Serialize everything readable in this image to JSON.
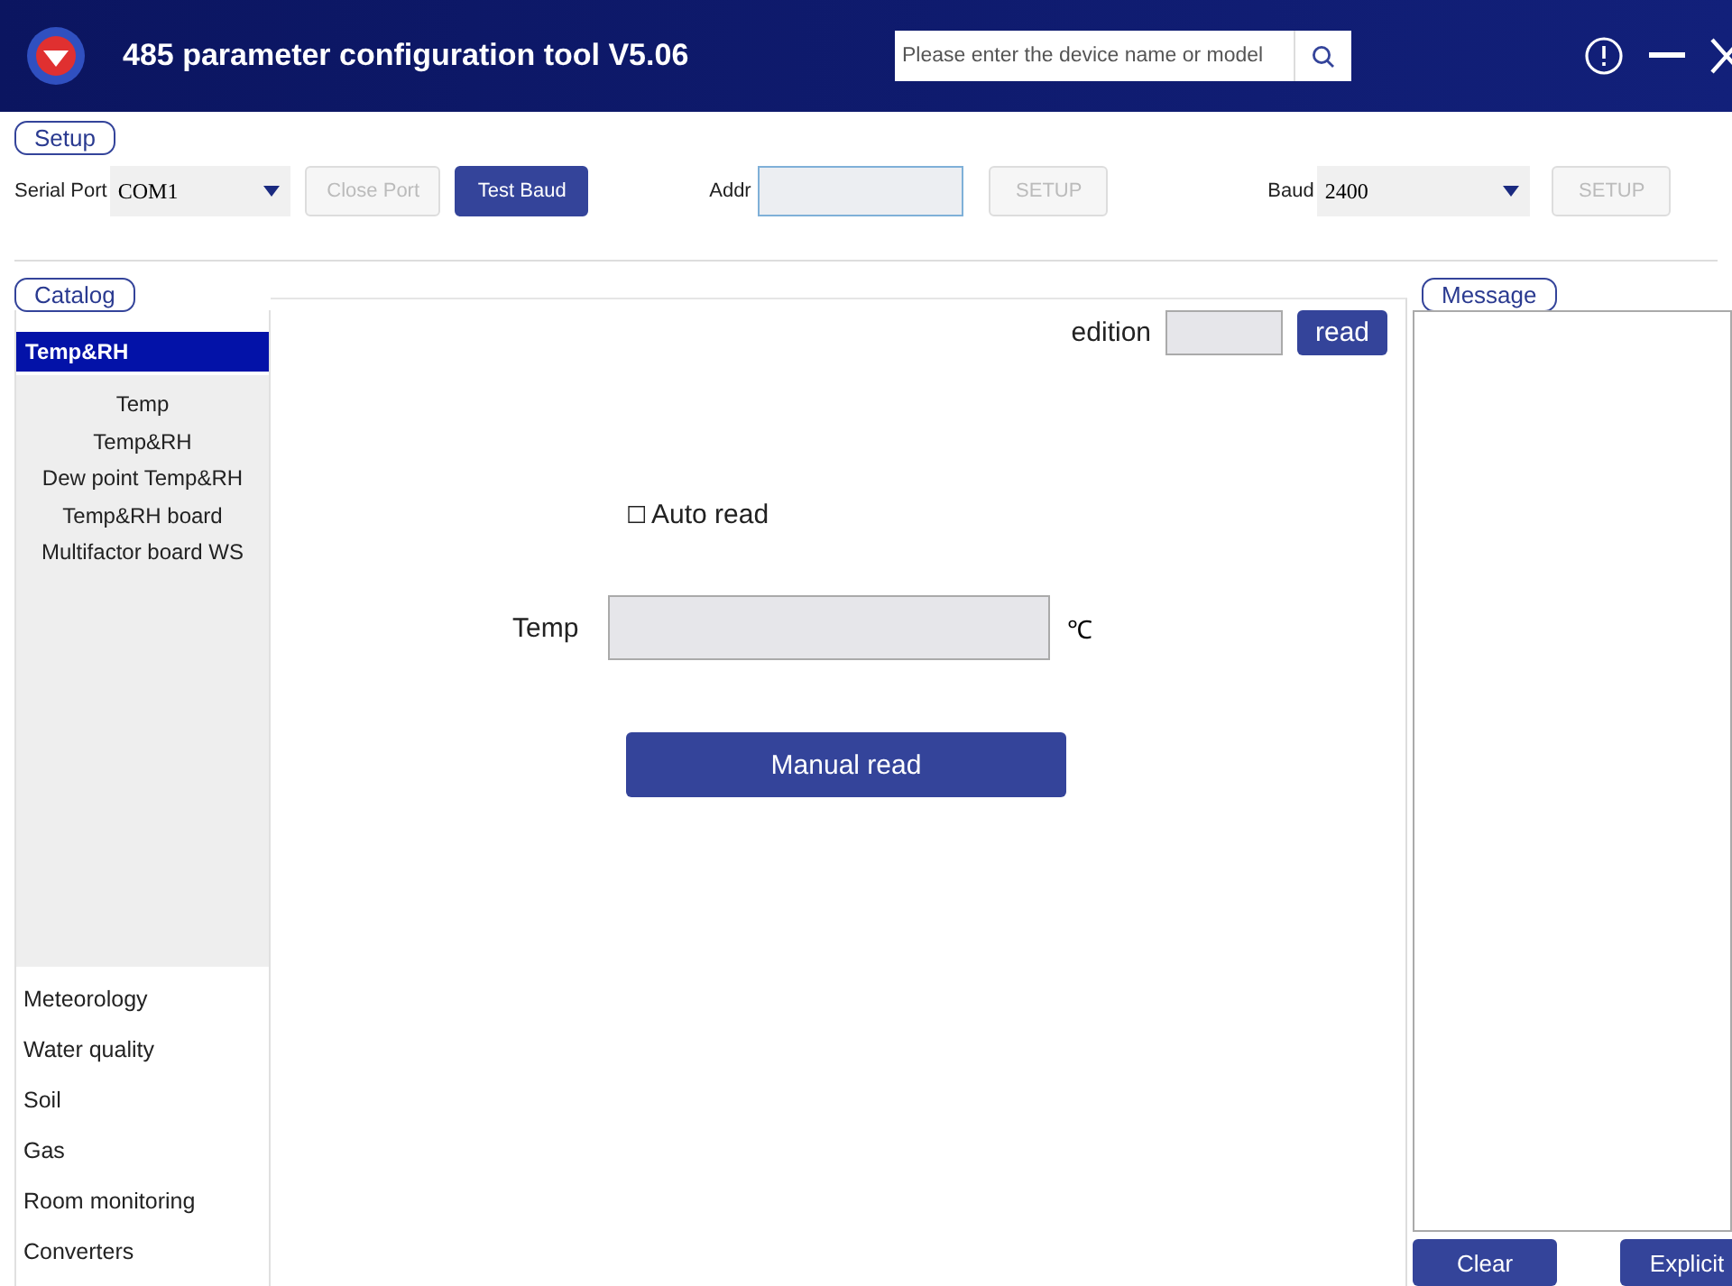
{
  "window": {
    "title": "485 parameter configuration tool V5.06"
  },
  "search": {
    "placeholder": "Please enter the device name or model"
  },
  "setup": {
    "title": "Setup",
    "serial_port": {
      "label": "Serial Port",
      "value": "COM1"
    },
    "buttons": [
      {
        "label": "Close Port",
        "disabled": true
      },
      {
        "label": "Test Baud",
        "disabled": false
      }
    ],
    "addr": {
      "label": "Addr",
      "button": {
        "label": "SETUP",
        "disabled": true
      }
    },
    "baud": {
      "label": "Baud",
      "value": "2400",
      "button": {
        "label": "SETUP",
        "disabled": true
      }
    }
  },
  "catalog": {
    "title": "Catalog",
    "group": {
      "label": "Temp&RH",
      "selected": true
    },
    "items": [
      {
        "label": "Temp",
        "selected": false
      },
      {
        "label": "Temp&RH",
        "selected": false
      },
      {
        "label": "Dew point Temp&RH",
        "selected": false
      },
      {
        "label": "Temp&RH board",
        "selected": false
      },
      {
        "label": "Multifactor board WS",
        "selected": false
      }
    ],
    "categories": [
      {
        "label": "Meteorology",
        "selected": false
      },
      {
        "label": "Water quality",
        "selected": false
      },
      {
        "label": "Soil",
        "selected": false
      },
      {
        "label": "Gas",
        "selected": false
      },
      {
        "label": "Room monitoring",
        "selected": false
      },
      {
        "label": "Converters",
        "selected": false
      }
    ]
  },
  "main": {
    "edition": {
      "label": "edition",
      "button": "read"
    },
    "auto_read": {
      "label": "Auto read",
      "checked": false,
      "box": "☐"
    },
    "temp": {
      "label": "Temp",
      "unit": "℃"
    },
    "manual_read": "Manual read"
  },
  "message": {
    "title": "Message",
    "buttons": [
      "Clear",
      "Explicit"
    ]
  }
}
